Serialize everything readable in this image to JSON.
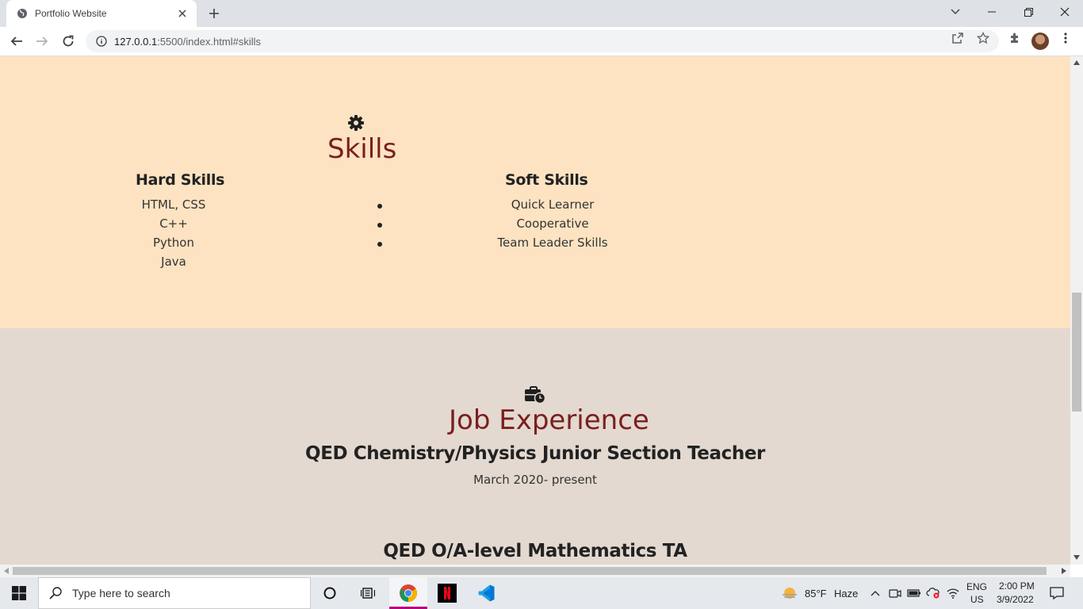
{
  "browser": {
    "tab_title": "Portfolio Website",
    "url_host": "127.0.0.1",
    "url_path": ":5500/index.html#skills"
  },
  "skills_section": {
    "icon": "gear-icon",
    "title": "Skills",
    "hard": {
      "title": "Hard Skills",
      "items": [
        "HTML, CSS",
        "C++",
        "Python",
        "Java"
      ]
    },
    "soft": {
      "title": "Soft Skills",
      "items": [
        "Quick Learner",
        "Cooperative",
        "Team Leader Skills"
      ]
    }
  },
  "jobs_section": {
    "icon": "briefcase-clock-icon",
    "title": "Job Experience",
    "jobs": [
      {
        "title": "QED Chemistry/Physics Junior Section Teacher",
        "date": "March 2020- present"
      },
      {
        "title": "QED O/A-level Mathematics TA"
      }
    ]
  },
  "taskbar": {
    "search_placeholder": "Type here to search",
    "weather_temp": "85°F",
    "weather_cond": "Haze",
    "lang": "ENG",
    "region": "US",
    "time": "2:00 PM",
    "date": "3/9/2022"
  },
  "colors": {
    "skills_bg": "#fde3c2",
    "jobs_bg": "#e3d9d0",
    "section_title": "#7b1e1e"
  }
}
